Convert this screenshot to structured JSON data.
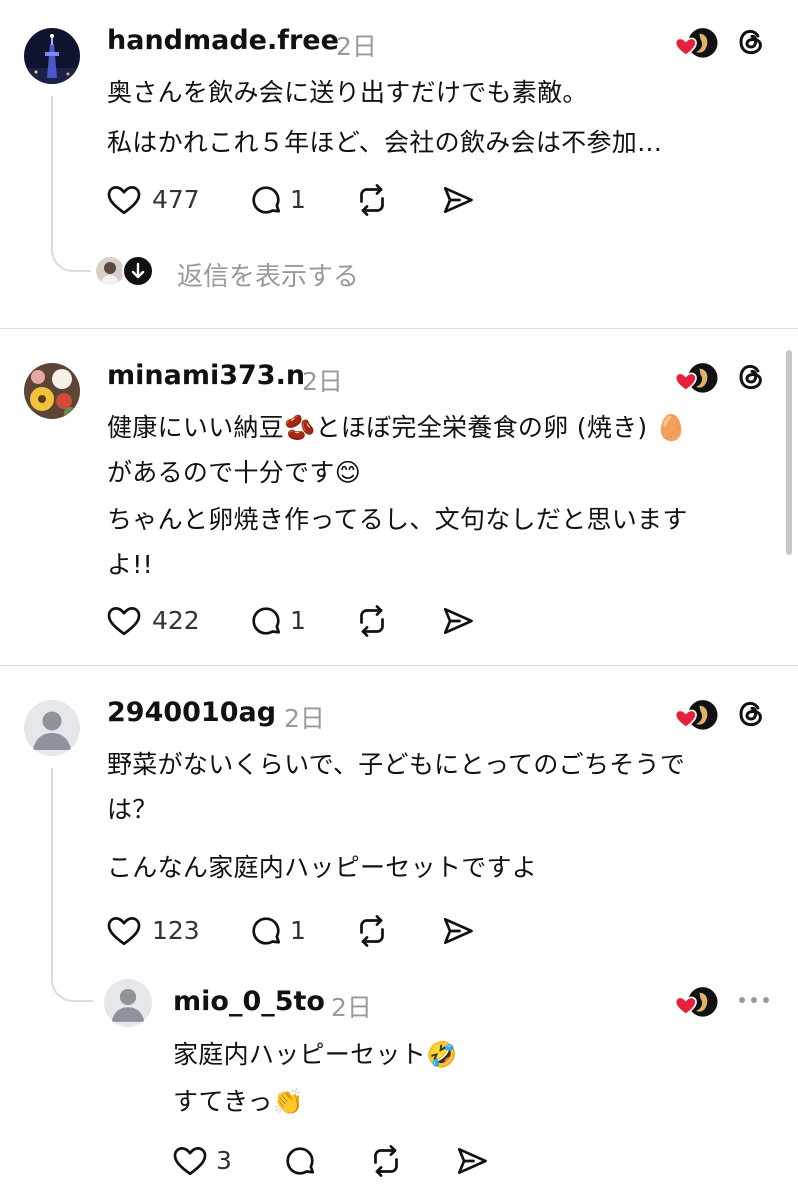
{
  "posts": [
    {
      "username": "handmade.free",
      "time": "2日",
      "lines": [
        "奥さんを飲み会に送り出すだけでも素敵。",
        "私はかれこれ５年ほど、会社の飲み会は不参加…"
      ],
      "likes": "477",
      "replies": "1",
      "view_replies": "返信を表示する"
    },
    {
      "username": "minami373.n",
      "time": "2日",
      "lines": [
        "健康にいい納豆🫘とほぼ完全栄養食の卵 (焼き) 🥚",
        "があるので十分です😊",
        "ちゃんと卵焼き作ってるし、文句なしだと思います",
        "よ!!"
      ],
      "likes": "422",
      "replies": "1"
    },
    {
      "username": "2940010ag",
      "time": "2日",
      "lines": [
        "野菜がないくらいで、子どもにとってのごちそうで",
        "は？",
        "こんなん家庭内ハッピーセットですよ"
      ],
      "likes": "123",
      "replies": "1"
    },
    {
      "username": "mio_0_5to",
      "time": "2日",
      "lines": [
        "家庭内ハッピーセット🤣",
        "すてきっ👏"
      ],
      "likes": "3"
    }
  ],
  "colors": {
    "heart": "#e8213b",
    "muted": "#9a9a9a",
    "divider": "#dcdcdc"
  },
  "icons": [
    "heart-icon",
    "comment-icon",
    "repost-icon",
    "share-icon",
    "threads-logo-icon",
    "more-icon",
    "default-avatar-icon",
    "down-arrow-icon"
  ]
}
